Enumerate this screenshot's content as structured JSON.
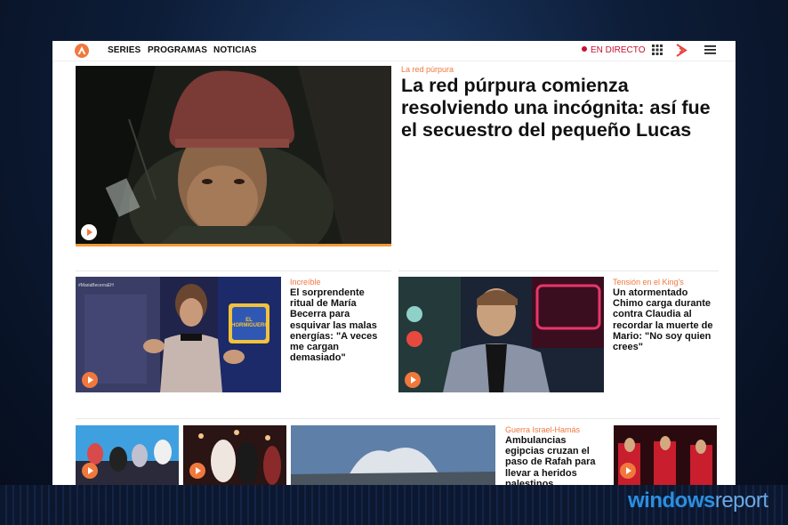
{
  "nav": {
    "links": [
      "SERIES",
      "PROGRAMAS",
      "NOTICIAS"
    ],
    "live_label": "EN DIRECTO"
  },
  "hero": {
    "kicker": "La red púrpura",
    "title": "La red púrpura comienza resolviendo una incógnita: así fue el secuestro del pequeño Lucas"
  },
  "cards": [
    {
      "kicker": "Increíble",
      "title": "El sorprendente ritual de María Becerra para esquivar las malas energías: \"A veces me cargan demasiado\""
    },
    {
      "kicker": "Tensión en el King's",
      "title": "Un atormentado Chimo carga durante contra Claudia al recordar la muerte de Mario: \"No soy quien crees\""
    },
    {
      "kicker": "Guerra Israel-Hamás",
      "title": "Ambulancias egipcias cruzan el paso de Rafah para llevar a heridos palestinos"
    }
  ],
  "thumb_captions": {
    "card1_tag": "#MariaBecerraEH",
    "card1_show": "EL HORMIGUERO"
  },
  "watermark": {
    "part1": "windows",
    "part2": "report"
  },
  "colors": {
    "accent": "#f0783c",
    "live": "#c8102e"
  }
}
